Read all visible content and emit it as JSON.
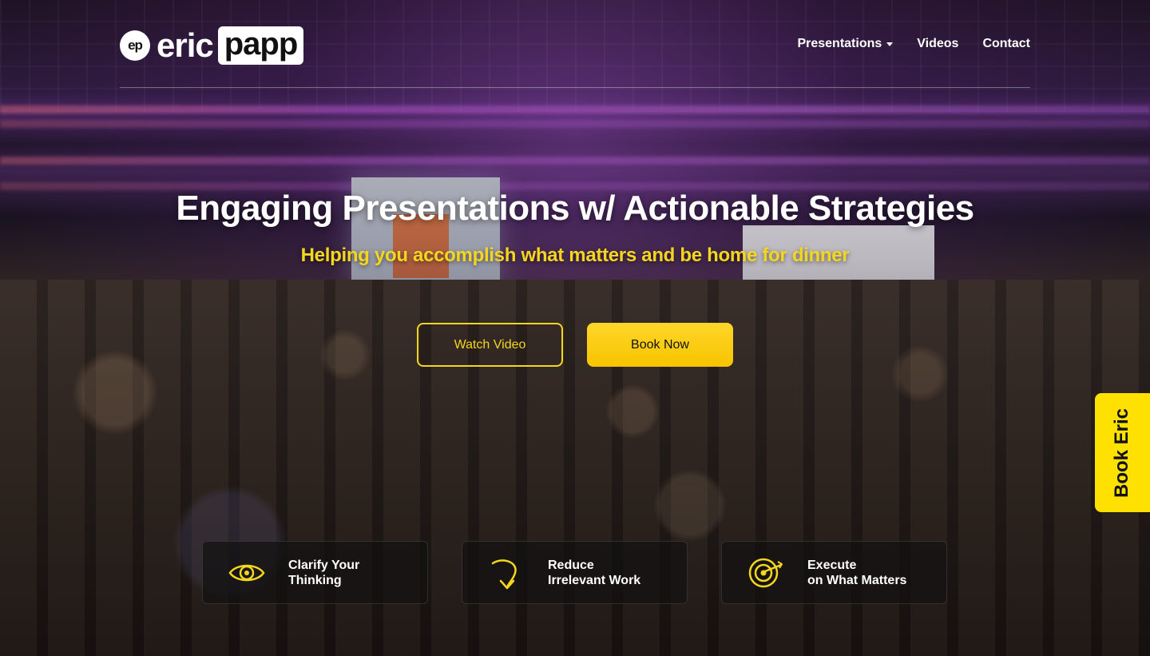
{
  "brand": {
    "mark": "ep",
    "first_name": "eric",
    "last_name": "papp"
  },
  "nav": {
    "items": [
      {
        "label": "Presentations",
        "has_dropdown": true
      },
      {
        "label": "Videos"
      },
      {
        "label": "Contact"
      }
    ]
  },
  "hero": {
    "title": "Engaging Presentations w/ Actionable Strategies",
    "subtitle": "Helping you accomplish what matters and be home for dinner",
    "primary_button": "Watch Video",
    "secondary_button": "Book Now"
  },
  "side_tab": {
    "label": "Book Eric"
  },
  "features": [
    {
      "icon": "eye-icon",
      "line1": "Clarify Your",
      "line2": "Thinking"
    },
    {
      "icon": "curved-arrow-down-icon",
      "line1": "Reduce",
      "line2": "Irrelevant Work"
    },
    {
      "icon": "target-arrow-icon",
      "line1": "Execute",
      "line2": "on What Matters"
    }
  ],
  "colors": {
    "accent_yellow": "#f5d61e",
    "button_yellow": "#ffd629",
    "side_tab_yellow": "#ffe100",
    "text_white": "#ffffff"
  }
}
